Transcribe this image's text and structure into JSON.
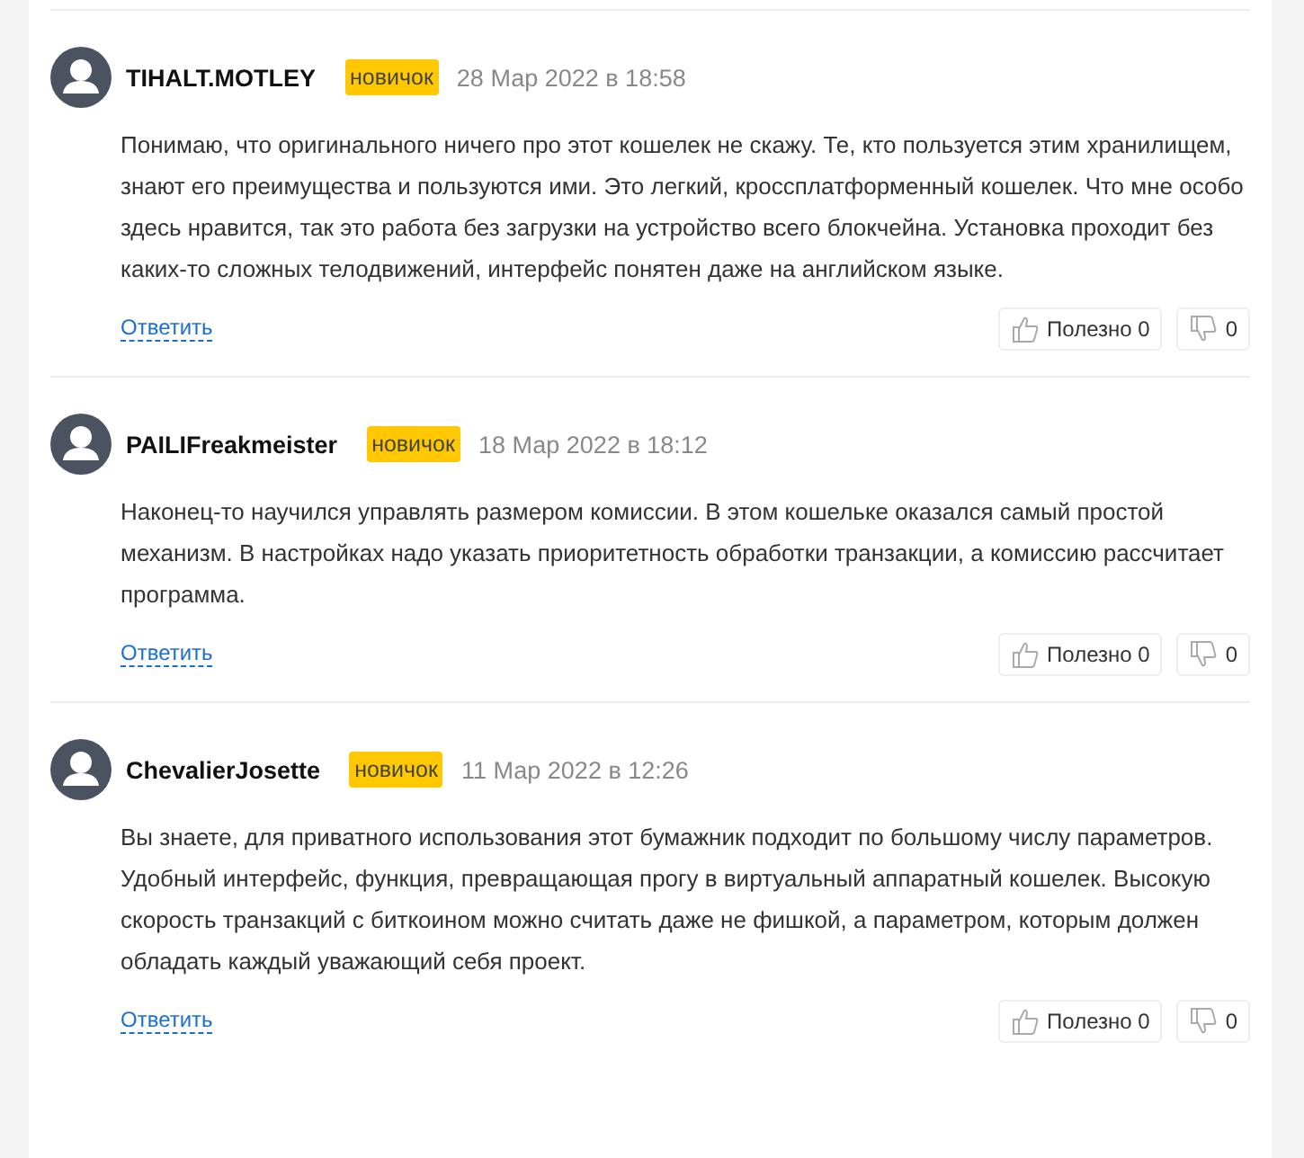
{
  "comments": [
    {
      "author": "TIHALT.MOTLEY",
      "badge": "новичок",
      "date": "28 Мар 2022 в 18:58",
      "text": "Понимаю, что оригинального ничего про этот кошелек не скажу. Те, кто пользуется этим хранилищем, знают его преимущества и пользуются ими. Это легкий, кроссплатформенный кошелек. Что мне особо здесь нравится, так это работа без загрузки на устройство всего блокчейна. Установка проходит без каких-то сложных телодвижений, интерфейс понятен даже на английском языке.",
      "reply": "Ответить",
      "useful_label": "Полезно",
      "useful_count": "0",
      "dislike_count": "0"
    },
    {
      "author": "PAILIFreakmeister",
      "badge": "новичок",
      "date": "18 Мар 2022 в 18:12",
      "text": "Наконец-то научился управлять размером комиссии. В этом кошельке оказался самый простой механизм. В настройках надо указать приоритетность обработки транзакции, а комиссию рассчитает программа.",
      "reply": "Ответить",
      "useful_label": "Полезно",
      "useful_count": "0",
      "dislike_count": "0"
    },
    {
      "author": "ChevalierJosette",
      "badge": "новичок",
      "date": "11 Мар 2022 в 12:26",
      "text": "Вы знаете, для приватного использования этот бумажник подходит по большому числу параметров. Удобный интерфейс, функция, превращающая прогу в виртуальный аппаратный кошелек. Высокую скорость транзакций с биткоином можно считать даже не фишкой, а параметром, которым должен обладать каждый уважающий себя проект.",
      "reply": "Ответить",
      "useful_label": "Полезно",
      "useful_count": "0",
      "dislike_count": "0"
    }
  ]
}
